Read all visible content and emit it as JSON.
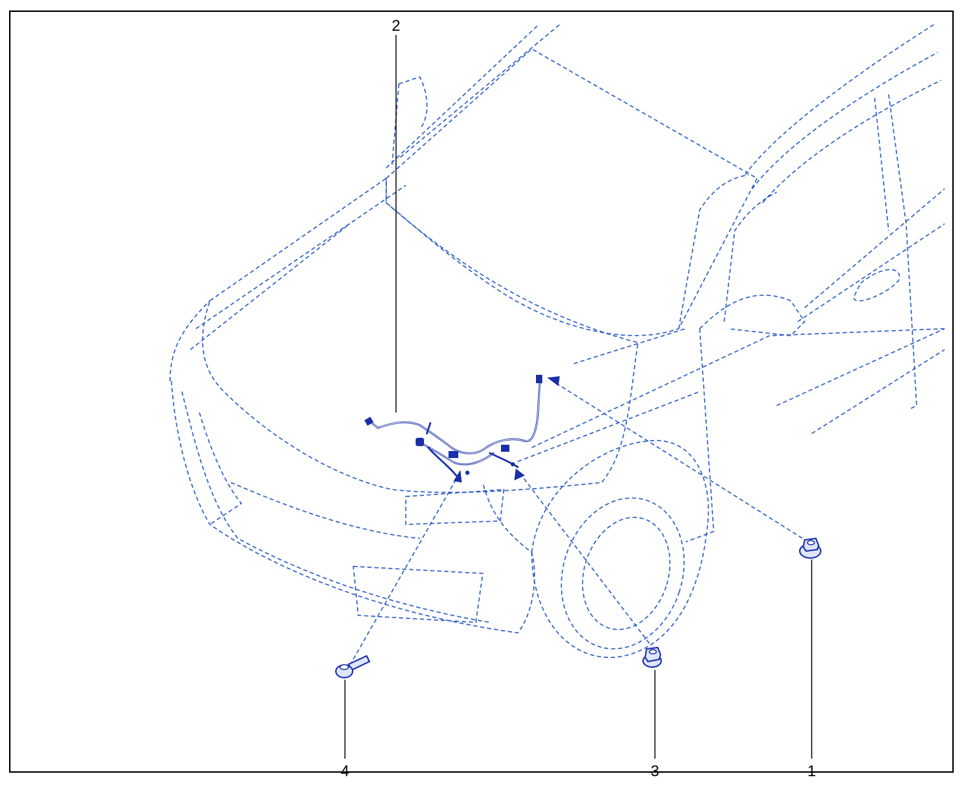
{
  "callouts": [
    {
      "label": "1"
    },
    {
      "label": "2"
    },
    {
      "label": "3"
    },
    {
      "label": "4"
    }
  ],
  "colors": {
    "outline": "#2f5fc4",
    "part": "#1a2fa8",
    "leader": "#000000",
    "border": "#000000"
  }
}
